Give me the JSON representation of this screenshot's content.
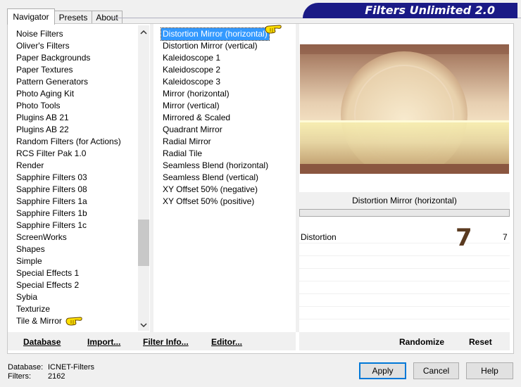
{
  "tabs": [
    {
      "label": "Navigator",
      "active": true
    },
    {
      "label": "Presets",
      "active": false
    },
    {
      "label": "About",
      "active": false
    }
  ],
  "banner_title": "Filters Unlimited 2.0",
  "categories": [
    "Noise Filters",
    "Oliver's Filters",
    "Paper Backgrounds",
    "Paper Textures",
    "Pattern Generators",
    "Photo Aging Kit",
    "Photo Tools",
    "Plugins AB 21",
    "Plugins AB 22",
    "Random Filters (for Actions)",
    "RCS Filter Pak 1.0",
    "Render",
    "Sapphire Filters 03",
    "Sapphire Filters 08",
    "Sapphire Filters 1a",
    "Sapphire Filters 1b",
    "Sapphire Filters 1c",
    "ScreenWorks",
    "Shapes",
    "Simple",
    "Special Effects 1",
    "Special Effects 2",
    "Sybia",
    "Texturize",
    "Tile & Mirror"
  ],
  "filters": [
    "Distortion Mirror (horizontal)",
    "Distortion Mirror (vertical)",
    "Kaleidoscope 1",
    "Kaleidoscope 2",
    "Kaleidoscope 3",
    "Mirror (horizontal)",
    "Mirror (vertical)",
    "Mirrored & Scaled",
    "Quadrant Mirror",
    "Radial Mirror",
    "Radial Tile",
    "Seamless Blend (horizontal)",
    "Seamless Blend (vertical)",
    "XY Offset 50% (negative)",
    "XY Offset 50% (positive)"
  ],
  "selected_filter_index": 0,
  "preview": {
    "filter_name": "Distortion Mirror (horizontal)",
    "param_label": "Distortion",
    "param_value": "7",
    "annotation": "7"
  },
  "buttons": {
    "database": "Database",
    "import": "Import...",
    "filter_info": "Filter Info...",
    "editor": "Editor...",
    "randomize": "Randomize",
    "reset": "Reset",
    "apply": "Apply",
    "cancel": "Cancel",
    "help": "Help"
  },
  "status": {
    "database_label": "Database:",
    "database_value": "ICNET-Filters",
    "filters_label": "Filters:",
    "filters_value": "2162"
  },
  "colors": {
    "banner": "#1a1a86",
    "selection": "#3399ff",
    "annotation": "#5a3a20"
  }
}
